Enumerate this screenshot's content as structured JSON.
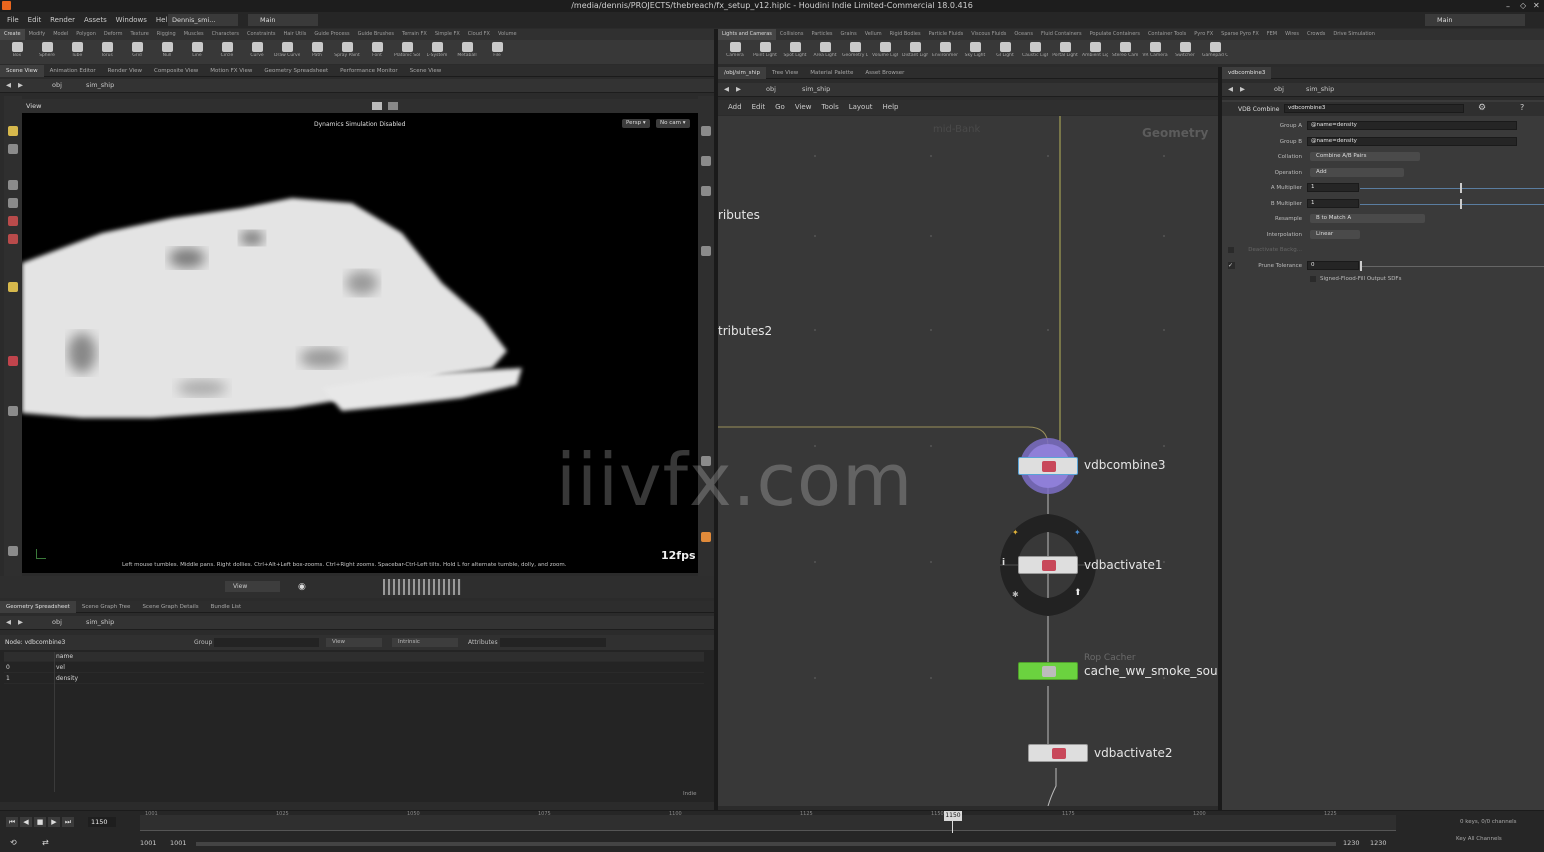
{
  "window": {
    "title": "/media/dennis/PROJECTS/thebreach/fx_setup_v12.hiplc - Houdini Indie Limited-Commercial 18.0.416"
  },
  "menu": [
    "File",
    "Edit",
    "Render",
    "Assets",
    "Windows",
    "Help"
  ],
  "desktop": {
    "session": "Dennis_smi...",
    "main": "Main"
  },
  "left_shelf_tabs": [
    "Create",
    "Modify",
    "Model",
    "Polygon",
    "Deform",
    "Texture",
    "Rigging",
    "Muscles",
    "Characters",
    "Constraints",
    "Hair Utils",
    "Guide Process",
    "Guide Brushes",
    "Terrain FX",
    "Simple FX",
    "Cloud FX",
    "Volume"
  ],
  "left_tools": [
    "Box",
    "Sphere",
    "Tube",
    "Torus",
    "Grid",
    "Null",
    "Line",
    "Circle",
    "Curve",
    "Draw Curve",
    "Path",
    "Spray Paint",
    "Font",
    "Platonic Solids",
    "L-System",
    "Metaball",
    "File"
  ],
  "right_shelf_tabs": [
    "Lights and Cameras",
    "Collisions",
    "Particles",
    "Grains",
    "Vellum",
    "Rigid Bodies",
    "Particle Fluids",
    "Viscous Fluids",
    "Oceans",
    "Fluid Containers",
    "Populate Containers",
    "Container Tools",
    "Pyro FX",
    "Sparse Pyro FX",
    "FEM",
    "Wires",
    "Crowds",
    "Drive Simulation"
  ],
  "right_tools": [
    "Camera",
    "Point Light",
    "Spot Light",
    "Area Light",
    "Geometry Light",
    "Volume Light",
    "Distant Light",
    "Environment Light",
    "Sky Light",
    "GI Light",
    "Caustic Light",
    "Portal Light",
    "Ambient Light",
    "Stereo Camera",
    "VR Camera",
    "Switcher",
    "Gamepad Camera"
  ],
  "viewport_tabs": [
    "Scene View",
    "Animation Editor",
    "Render View",
    "Composite View",
    "Motion FX View",
    "Geometry Spreadsheet",
    "Performance Monitor",
    "Scene View"
  ],
  "viewport_path": {
    "root": "obj",
    "node": "sim_ship"
  },
  "viewport": {
    "view_label": "View",
    "status": "Dynamics Simulation Disabled",
    "persp": "Persp",
    "cam": "No cam",
    "fps": "12fps",
    "hint": "Left mouse tumbles. Middle pans. Right dollies. Ctrl+Alt+Left box-zooms. Ctrl+Right zooms. Spacebar-Ctrl-Left tilts. Hold L for alternate tumble, dolly, and zoom.",
    "view_dropdown": "View",
    "watermark": "iiivfx.com"
  },
  "network_tabs": [
    "/obj/sim_ship",
    "Tree View",
    "Material Palette",
    "Asset Browser"
  ],
  "network_path": {
    "root": "obj",
    "node": "sim_ship"
  },
  "network_menu": [
    "Add",
    "Edit",
    "Go",
    "View",
    "Tools",
    "Layout",
    "Help"
  ],
  "network": {
    "context_label": "Geometry",
    "faded_label": "mid-Bank",
    "partial_1": "ributes",
    "partial_2": "tributes2",
    "nodes": [
      {
        "name": "vdbcombine3"
      },
      {
        "name": "vdbactivate1"
      },
      {
        "name": "cache_ww_smoke_sour",
        "subtitle": "Rop Cacher"
      },
      {
        "name": "vdbactivate2"
      }
    ]
  },
  "params_tab": "vdbcombine3",
  "params_path": {
    "root": "obj",
    "node": "sim_ship"
  },
  "params": {
    "node_type": "VDB Combine",
    "node_name": "vdbcombine3",
    "group_a": {
      "label": "Group A",
      "value": "@name=density"
    },
    "group_b": {
      "label": "Group B",
      "value": "@name=density"
    },
    "collation": {
      "label": "Collation",
      "value": "Combine A/B Pairs"
    },
    "operation": {
      "label": "Operation",
      "value": "Add"
    },
    "a_mult": {
      "label": "A Multiplier",
      "value": "1"
    },
    "b_mult": {
      "label": "B Multiplier",
      "value": "1"
    },
    "resample": {
      "label": "Resample",
      "value": "B to Match A"
    },
    "interp": {
      "label": "Interpolation",
      "value": "Linear"
    },
    "deactivate": {
      "label": "Deactivate Backg..."
    },
    "prune": {
      "label": "Prune Tolerance",
      "value": "0"
    },
    "sdf": {
      "label": "Signed-Flood-Fill Output SDFs"
    }
  },
  "spreadsheet_tabs": [
    "Geometry Spreadsheet",
    "Scene Graph Tree",
    "Scene Graph Details",
    "Bundle List"
  ],
  "spreadsheet_path": {
    "root": "obj",
    "node": "sim_ship"
  },
  "spreadsheet": {
    "node_label": "Node: vdbcombine3",
    "group_label": "Group",
    "view_label": "View",
    "intrinsic_label": "Intrinsic",
    "attributes_label": "Attributes",
    "col_name": "name",
    "rows": [
      {
        "idx": "0",
        "name": "vel"
      },
      {
        "idx": "1",
        "name": "density"
      }
    ],
    "corner": "Indie"
  },
  "timeline": {
    "current_frame": "1150",
    "start": "1001",
    "start2": "1001",
    "end": "1230",
    "end2": "1230",
    "marker": "1150",
    "keys": "0 keys, 0/0 channels",
    "channels": "Key All Channels",
    "ticks": [
      "1001",
      "1025",
      "1050",
      "1075",
      "1100",
      "1125",
      "1150",
      "1175",
      "1200",
      "1225"
    ]
  }
}
